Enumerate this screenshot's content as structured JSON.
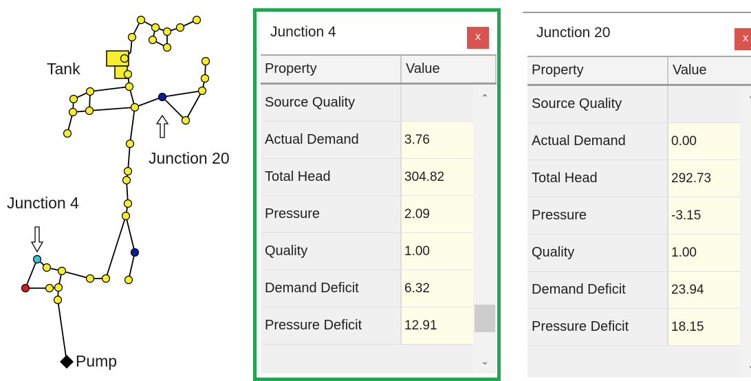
{
  "diagram": {
    "labels": {
      "tank": "Tank",
      "junction20": "Junction 20",
      "junction4": "Junction 4",
      "pump": "Pump"
    },
    "colors": {
      "node": "#f6ee2a",
      "node_highlight_blue": "#0a1da0",
      "node_junction4": "#33c4d6",
      "node_red": "#d81c1c",
      "tank": "#f6ee2a",
      "pump": "#000000"
    }
  },
  "panels": [
    {
      "title": "Junction 4",
      "close_label": "x",
      "columns": [
        "Property",
        "Value"
      ],
      "rows": [
        {
          "property": "Source Quality",
          "value": ""
        },
        {
          "property": "Actual Demand",
          "value": "3.76"
        },
        {
          "property": "Total Head",
          "value": "304.82"
        },
        {
          "property": "Pressure",
          "value": "2.09"
        },
        {
          "property": "Quality",
          "value": "1.00"
        },
        {
          "property": "Demand Deficit",
          "value": "6.32"
        },
        {
          "property": "Pressure Deficit",
          "value": "12.91"
        }
      ]
    },
    {
      "title": "Junction 20",
      "close_label": "x",
      "columns": [
        "Property",
        "Value"
      ],
      "rows": [
        {
          "property": "Source Quality",
          "value": ""
        },
        {
          "property": "Actual Demand",
          "value": "0.00"
        },
        {
          "property": "Total Head",
          "value": "292.73"
        },
        {
          "property": "Pressure",
          "value": "-3.15"
        },
        {
          "property": "Quality",
          "value": "1.00"
        },
        {
          "property": "Demand Deficit",
          "value": "23.94"
        },
        {
          "property": "Pressure Deficit",
          "value": "18.15"
        }
      ]
    }
  ],
  "icons": {
    "scroll_up": "chevron-up-icon",
    "scroll_down": "chevron-down-icon",
    "close": "close-icon"
  }
}
